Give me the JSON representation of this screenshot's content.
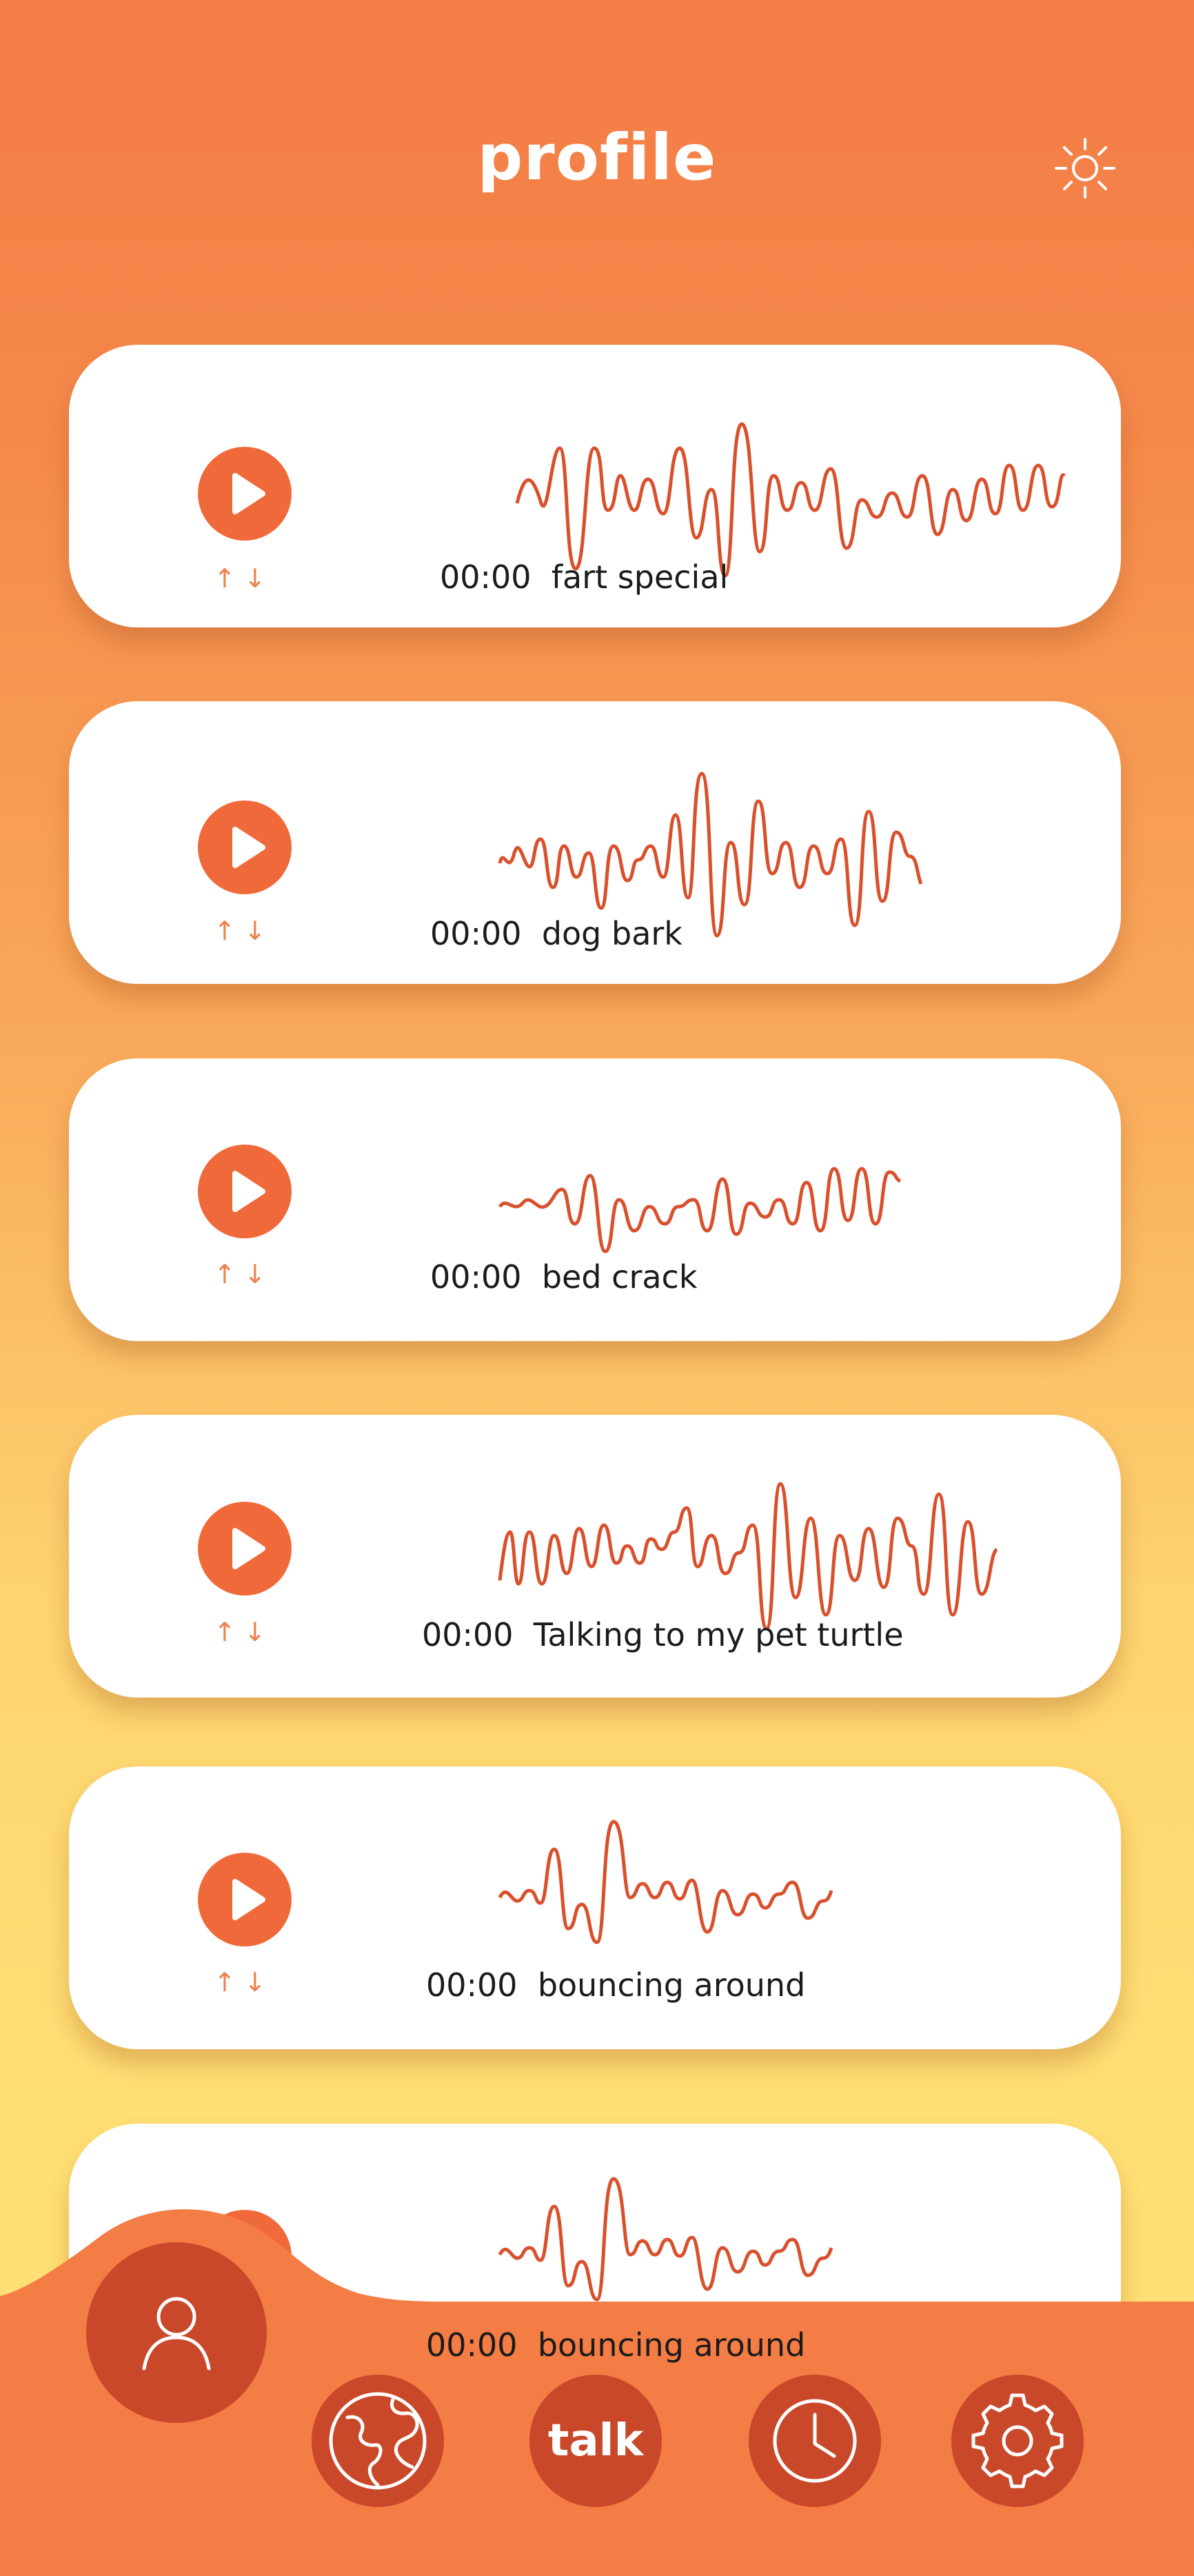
{
  "header": {
    "title": "profile",
    "theme_icon": "sun-icon"
  },
  "recordings": [
    {
      "time": "00:00",
      "name": "fart special"
    },
    {
      "time": "00:00",
      "name": "dog bark"
    },
    {
      "time": "00:00",
      "name": "bed crack"
    },
    {
      "time": "00:00",
      "name": "Talking to my pet turtle"
    },
    {
      "time": "00:00",
      "name": "bouncing around"
    },
    {
      "time": "00:00",
      "name": "bouncing around"
    }
  ],
  "controls": {
    "play_icon": "play-icon",
    "sort_up": "↑",
    "sort_down": "↓"
  },
  "nav": {
    "profile_icon": "user-icon",
    "explore_icon": "globe-icon",
    "talk_label": "talk",
    "history_icon": "clock-icon",
    "settings_icon": "gear-icon"
  },
  "colors": {
    "accent": "#F0693A",
    "nav_button": "#C9482A",
    "bar": "#F47C45",
    "waveform": "#D9502C",
    "gradient_top": "#F47C45",
    "gradient_bottom": "#FFE074"
  }
}
